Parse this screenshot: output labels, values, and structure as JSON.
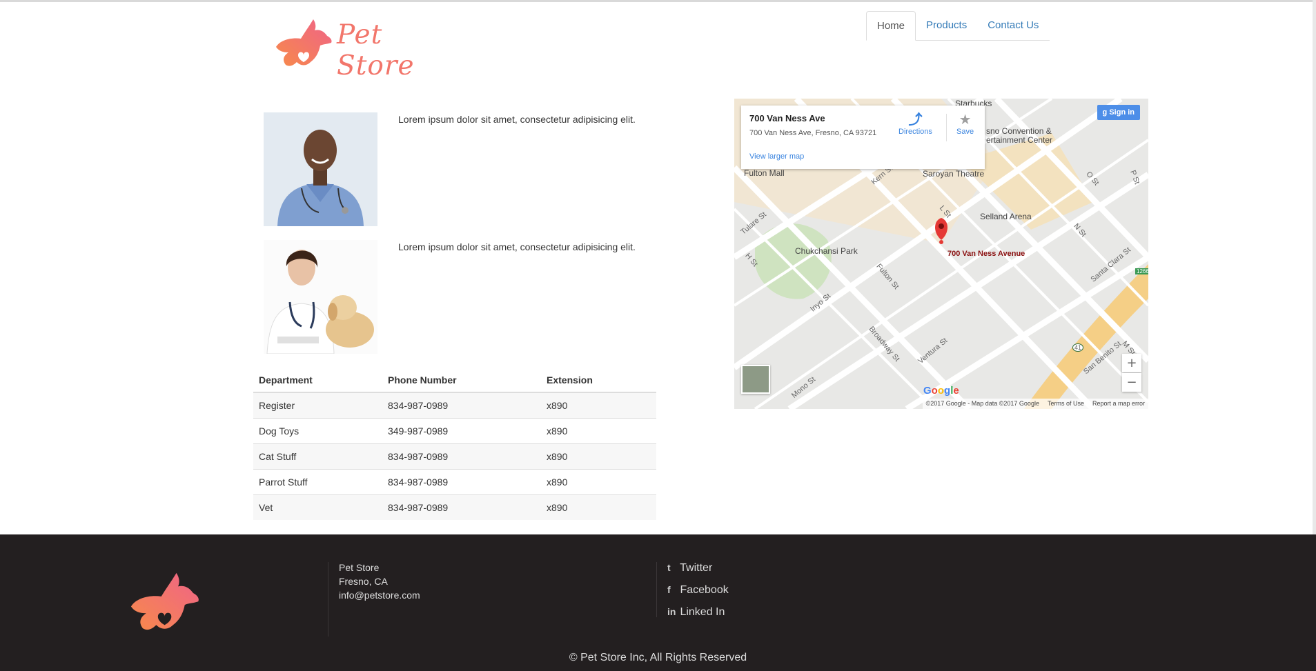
{
  "brand": {
    "name": "Pet Store",
    "accent": "#f2766b"
  },
  "nav": {
    "items": [
      "Home",
      "Products",
      "Contact Us"
    ],
    "active": "Home"
  },
  "staff": [
    {
      "photo": "male-vet-photo",
      "text": "Lorem ipsum dolor sit amet, consectetur adipisicing elit."
    },
    {
      "photo": "female-vet-with-puppy-photo",
      "text": "Lorem ipsum dolor sit amet, consectetur adipisicing elit."
    }
  ],
  "table": {
    "headers": [
      "Department",
      "Phone Number",
      "Extension"
    ],
    "rows": [
      [
        "Register",
        "834-987-0989",
        "x890"
      ],
      [
        "Dog Toys",
        "349-987-0989",
        "x890"
      ],
      [
        "Cat Stuff",
        "834-987-0989",
        "x890"
      ],
      [
        "Parrot Stuff",
        "834-987-0989",
        "x890"
      ],
      [
        "Vet",
        "834-987-0989",
        "x890"
      ]
    ]
  },
  "map": {
    "card_title": "700 Van Ness Ave",
    "card_address": "700 Van Ness Ave, Fresno, CA 93721",
    "directions_label": "Directions",
    "save_label": "Save",
    "larger_map_label": "View larger map",
    "signin_label": "Sign in",
    "pin_label": "700 Van Ness Avenue",
    "zoom_in": "+",
    "zoom_out": "−",
    "google_logo": "Google",
    "places": [
      "Starbucks",
      "sno Convention &",
      "ertainment Center",
      "Fulton Mall",
      "Saroyan Theatre",
      "Selland Arena",
      "Chukchansi Park"
    ],
    "streets": [
      "Tulare St",
      "H St",
      "Inyo St",
      "Fulton St",
      "Broadway St",
      "Ventura St",
      "Mono St",
      "L St",
      "N St",
      "O St",
      "Santa Clara St",
      "San Benito St",
      "M St",
      "Kern St",
      "P St",
      "1266",
      "41"
    ],
    "footer": {
      "copyright": "©2017 Google - Map data ©2017 Google",
      "terms": "Terms of Use",
      "report": "Report a map error"
    }
  },
  "footer": {
    "address": [
      "Pet Store",
      "Fresno, CA",
      "info@petstore.com"
    ],
    "social": [
      {
        "icon": "twitter-icon",
        "glyph": "t",
        "label": "Twitter"
      },
      {
        "icon": "facebook-icon",
        "glyph": "f",
        "label": "Facebook"
      },
      {
        "icon": "linkedin-icon",
        "glyph": "in",
        "label": "Linked In"
      }
    ],
    "copyright": "© Pet Store Inc, All Rights Reserved",
    "background": "#231f20"
  }
}
